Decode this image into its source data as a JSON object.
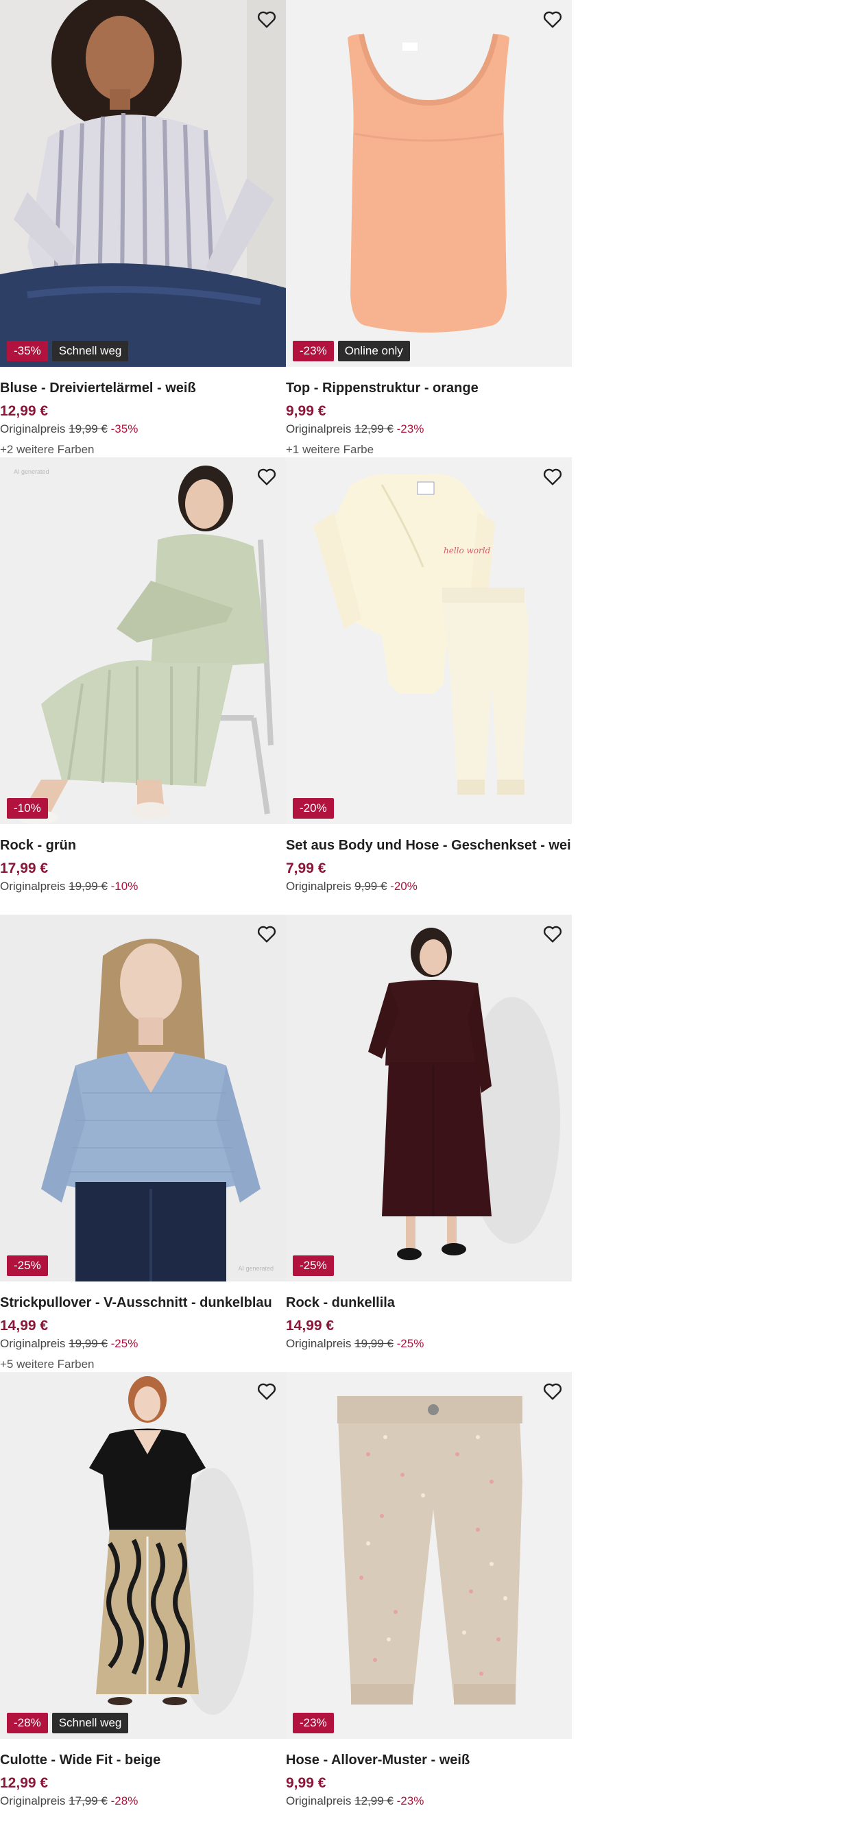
{
  "products": [
    {
      "title": "Bluse - Dreiviertelärmel - weiß",
      "price": "12,99 €",
      "orig_label": "Originalpreis",
      "orig_price": "19,99 €",
      "discount": "-35%",
      "badge_discount": "-35%",
      "badge_flag": "Schnell weg",
      "more_colors": "+2 weitere Farben"
    },
    {
      "title": "Top - Rippenstruktur - orange",
      "price": "9,99 €",
      "orig_label": "Originalpreis",
      "orig_price": "12,99 €",
      "discount": "-23%",
      "badge_discount": "-23%",
      "badge_flag": "Online only",
      "more_colors": "+1 weitere Farbe"
    },
    {
      "title": "Rock - grün",
      "price": "17,99 €",
      "orig_label": "Originalpreis",
      "orig_price": "19,99 €",
      "discount": "-10%",
      "badge_discount": "-10%",
      "ai_label": "AI generated"
    },
    {
      "title": "Set aus Body und Hose - Geschenkset - weiß",
      "price": "7,99 €",
      "orig_label": "Originalpreis",
      "orig_price": "9,99 €",
      "discount": "-20%",
      "badge_discount": "-20%"
    },
    {
      "title": "Strickpullover - V-Ausschnitt - dunkelblau",
      "price": "14,99 €",
      "orig_label": "Originalpreis",
      "orig_price": "19,99 €",
      "discount": "-25%",
      "badge_discount": "-25%",
      "more_colors": "+5 weitere Farben",
      "ai_label": "AI generated"
    },
    {
      "title": "Rock - dunkellila",
      "price": "14,99 €",
      "orig_label": "Originalpreis",
      "orig_price": "19,99 €",
      "discount": "-25%",
      "badge_discount": "-25%"
    },
    {
      "title": "Culotte - Wide Fit - beige",
      "price": "12,99 €",
      "orig_label": "Originalpreis",
      "orig_price": "17,99 €",
      "discount": "-28%",
      "badge_discount": "-28%",
      "badge_flag": "Schnell weg"
    },
    {
      "title": "Hose - Allover-Muster - weiß",
      "price": "9,99 €",
      "orig_label": "Originalpreis",
      "orig_price": "12,99 €",
      "discount": "-23%",
      "badge_discount": "-23%"
    }
  ],
  "icons": {
    "favorite": "heart-outline-icon"
  },
  "colors": {
    "price": "#8a1638",
    "discount_badge": "#b2123e",
    "flag_badge": "#2c2c2c"
  }
}
